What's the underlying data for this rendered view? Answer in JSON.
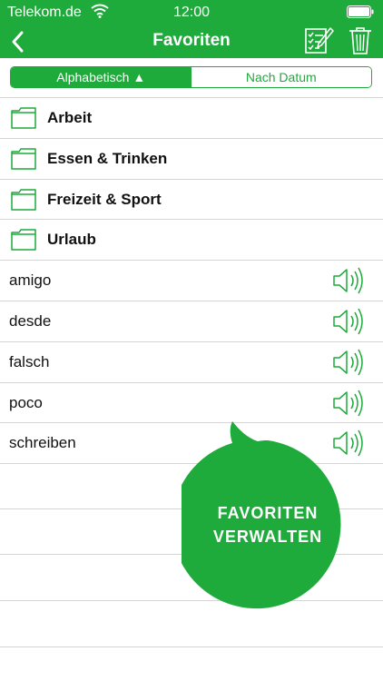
{
  "status_bar": {
    "carrier": "Telekom.de",
    "time": "12:00"
  },
  "nav": {
    "title": "Favoriten"
  },
  "sort": {
    "alphabetical": "Alphabetisch ▲",
    "by_date": "Nach Datum",
    "selected": "alphabetical"
  },
  "folders": [
    {
      "label": "Arbeit"
    },
    {
      "label": "Essen & Trinken"
    },
    {
      "label": "Freizeit & Sport"
    },
    {
      "label": "Urlaub"
    }
  ],
  "words": [
    {
      "label": "amigo"
    },
    {
      "label": "desde"
    },
    {
      "label": "falsch"
    },
    {
      "label": "poco"
    },
    {
      "label": "schreiben"
    }
  ],
  "fab": {
    "line1": "FAVORITEN",
    "line2": "VERWALTEN"
  },
  "colors": {
    "accent": "#1faa3c",
    "separator": "#d4d4d4"
  },
  "icons": {
    "back": "chevron-left-icon",
    "edit": "checklist-edit-icon",
    "delete": "trash-icon",
    "folder": "folder-icon",
    "audio": "speaker-icon"
  }
}
